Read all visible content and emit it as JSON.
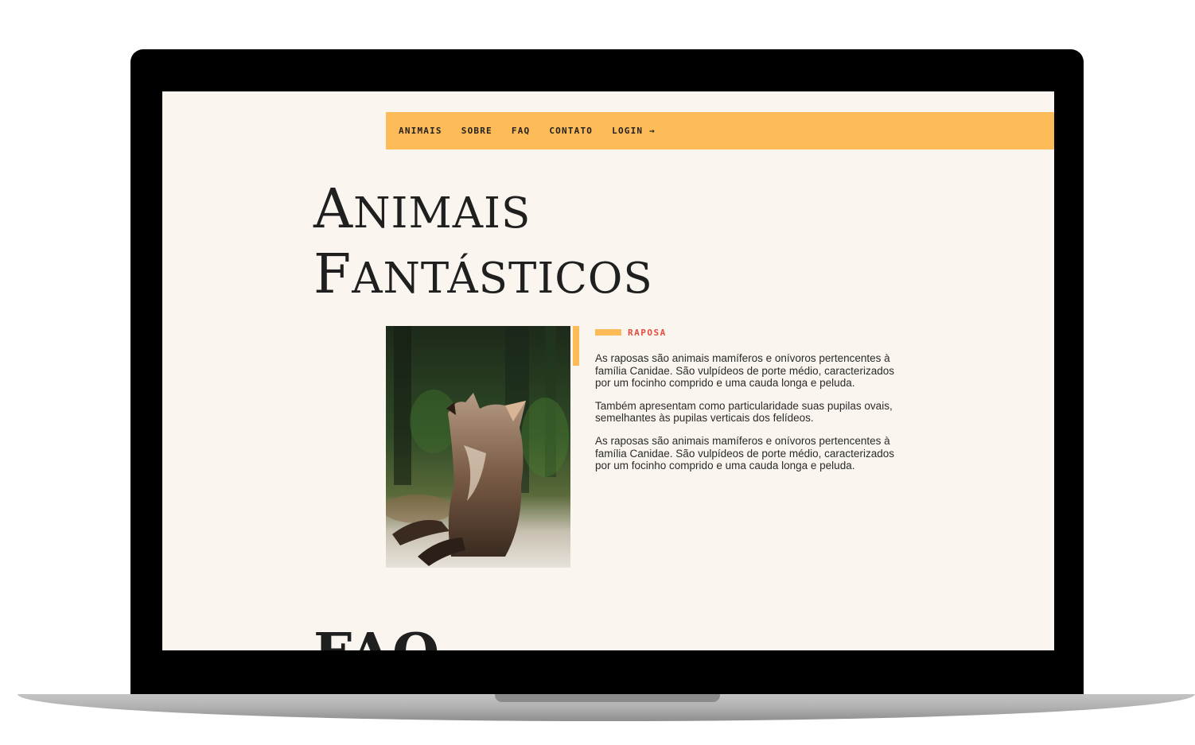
{
  "nav": {
    "items": [
      {
        "label": "ANIMAIS"
      },
      {
        "label": "SOBRE"
      },
      {
        "label": "FAQ"
      },
      {
        "label": "CONTATO"
      },
      {
        "label": "LOGIN →"
      }
    ]
  },
  "hero": {
    "title_line1": "Animais",
    "title_line2": "Fantásticos"
  },
  "animal": {
    "photo_icon": "fox-photo",
    "subtitle": "RAPOSA",
    "paragraphs": [
      "As raposas são animais mamíferos e onívoros pertencentes à família Canidae. São vulpídeos de porte médio, caracterizados por um focinho comprido e uma cauda longa e peluda.",
      "Também apresentam como particularidade suas pupilas ovais, semelhantes às pupilas verticais dos felídeos.",
      "As raposas são animais mamíferos e onívoros pertencentes à família Canidae. São vulpídeos de porte médio, caracterizados por um focinho comprido e uma cauda longa e peluda."
    ]
  },
  "faq": {
    "title": "FAQ"
  },
  "colors": {
    "accent": "#fdbb57",
    "subtitle": "#e54b3c",
    "background": "#faf6ef",
    "text": "#1f1f1f"
  }
}
